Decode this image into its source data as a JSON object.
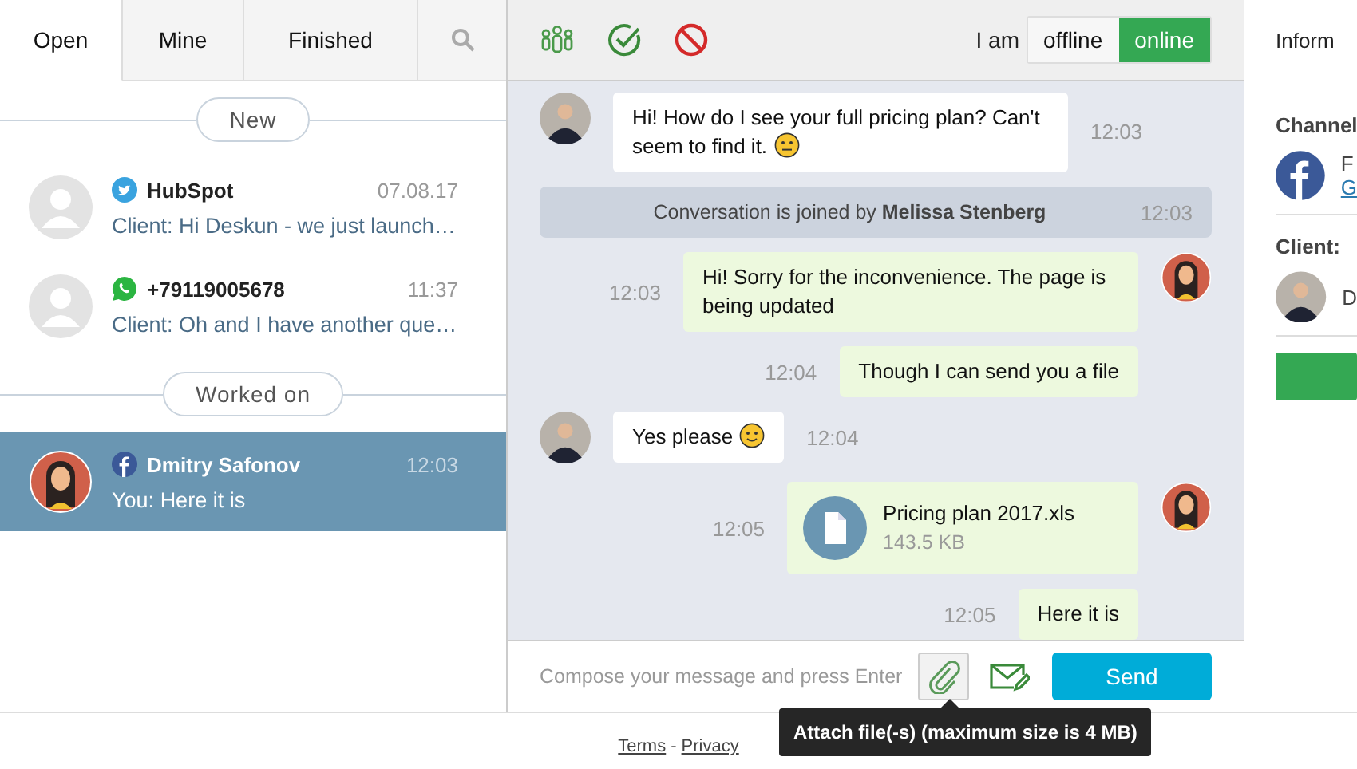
{
  "tabs": [
    {
      "label": "Open",
      "selected": true
    },
    {
      "label": "Mine",
      "selected": false
    },
    {
      "label": "Finished",
      "selected": false
    }
  ],
  "sections": [
    {
      "label": "New",
      "conversations": [
        {
          "kind": "twitter",
          "photo": false,
          "name": "HubSpot",
          "time": "07.08.17",
          "prefix": "Client:",
          "preview": "Hi Deskun - we just launch…",
          "selected": false
        },
        {
          "kind": "whatsapp",
          "photo": false,
          "name": "+79119005678",
          "time": "11:37",
          "prefix": "Client:",
          "preview": "Oh and I have another que…",
          "selected": false
        }
      ]
    },
    {
      "label": "Worked on",
      "conversations": [
        {
          "kind": "facebook",
          "photo": true,
          "name": "Dmitry Safonov",
          "time": "12:03",
          "prefix": "You:",
          "preview": "Here it is",
          "selected": true
        }
      ]
    }
  ],
  "status": {
    "label": "I am",
    "options": [
      {
        "label": "offline",
        "selected": false
      },
      {
        "label": "online",
        "selected": true
      }
    ]
  },
  "messages": [
    {
      "kind": "incoming",
      "text": "Hi! How do I see your full pricing plan? Can't seem to find it.",
      "emoji": {
        "kind": "neutral"
      },
      "time": "12:03",
      "avatar": true
    },
    {
      "kind": "system",
      "text": "Conversation is joined by **Melissa Stenberg**",
      "time": "12:03"
    },
    {
      "kind": "outgoing",
      "text": "Hi! Sorry for the inconvenience. The page is being updated",
      "time": "12:03",
      "avatar": true
    },
    {
      "kind": "outgoing",
      "text": "Though I can send you a file",
      "time": "12:04",
      "avatar": false
    },
    {
      "kind": "incoming",
      "text": "Yes please",
      "emoji": {
        "kind": "smile"
      },
      "time": "12:04",
      "avatar": true
    },
    {
      "kind": "file",
      "name": "Pricing plan 2017.xls",
      "size": "143.5 KB",
      "time": "12:05",
      "avatar": true
    },
    {
      "kind": "outgoing",
      "text": "Here it is",
      "time": "12:05",
      "avatar": false
    }
  ],
  "compose": {
    "placeholder": "Compose your message and press Enter",
    "send": "Send",
    "tooltip": "Attach file(-s) (maximum size is 4 MB)"
  },
  "info": {
    "tab": "Inform",
    "channel_heading": "Channel",
    "channel_name": "F",
    "channel_link": "G",
    "client_heading": "Client:",
    "client_name": "D"
  },
  "footer": {
    "links": [
      "Terms",
      "Privacy"
    ],
    "separator": "-"
  }
}
